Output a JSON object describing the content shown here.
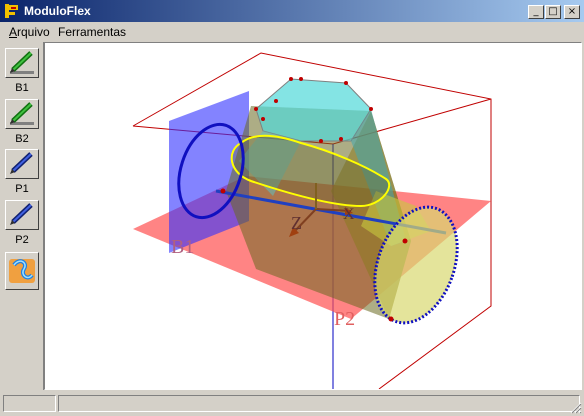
{
  "window": {
    "title": "ModuloFlex",
    "minimize": "_",
    "maximize": "□",
    "close": "×"
  },
  "menu": {
    "arquivo": "Arquivo",
    "arquivo_mnemonic": "A",
    "arquivo_rest": "rquivo",
    "ferramentas": "Ferramentas"
  },
  "toolbar": {
    "tools": [
      {
        "label": "B1",
        "icon": "green-pencil-icon"
      },
      {
        "label": "B2",
        "icon": "green-pencil-icon"
      },
      {
        "label": "P1",
        "icon": "blue-pencil-icon"
      },
      {
        "label": "P2",
        "icon": "blue-pencil-icon"
      },
      {
        "label": "",
        "icon": "flex-module-icon"
      }
    ]
  },
  "scene": {
    "labels": {
      "b1": "B1",
      "p2": "P2",
      "z": "Z",
      "x": "X"
    },
    "colors": {
      "bounding_box_red": "#c00000",
      "bounding_box_blue": "#0000c0",
      "plane_red": "#ff6060",
      "plane_blue": "#4040ff",
      "profile_blue": "#1010c0",
      "hull_cyan": "#40d0d0",
      "path_yellow": "#ffff00"
    }
  },
  "status": {
    "pane1": "",
    "pane2": ""
  }
}
